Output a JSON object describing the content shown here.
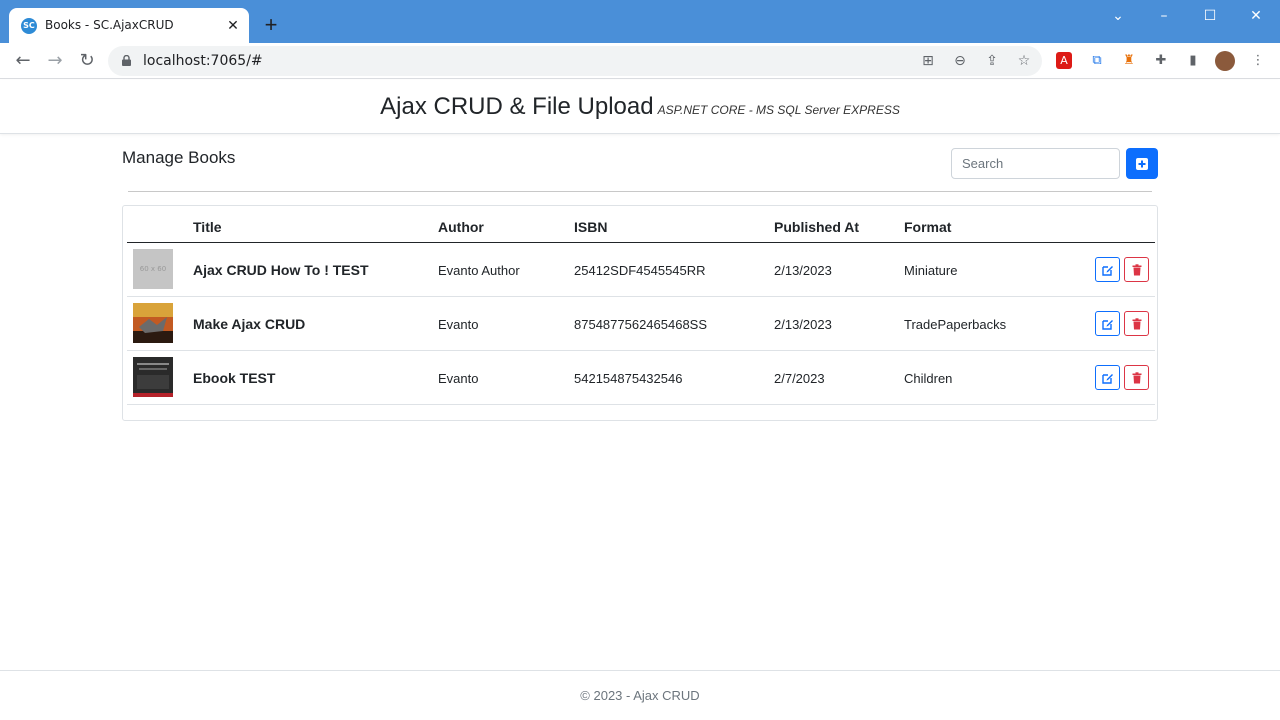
{
  "browser": {
    "tab_title": "Books - SC.AjaxCRUD",
    "favicon_text": "SC",
    "url": "localhost:7065/#"
  },
  "header": {
    "title": "Ajax CRUD & File Upload",
    "subtitle": "ASP.NET CORE - MS SQL Server EXPRESS"
  },
  "main": {
    "title": "Manage Books",
    "search_placeholder": "Search",
    "columns": [
      "Title",
      "Author",
      "ISBN",
      "Published At",
      "Format"
    ],
    "rows": [
      {
        "title": "Ajax CRUD How To ! TEST",
        "author": "Evanto Author",
        "isbn": "25412SDF4545545RR",
        "published": "2/13/2023",
        "format": "Miniature",
        "thumb": "60 x 60"
      },
      {
        "title": "Make Ajax CRUD",
        "author": "Evanto",
        "isbn": "8754877562465468SS",
        "published": "2/13/2023",
        "format": "TradePaperbacks"
      },
      {
        "title": "Ebook TEST",
        "author": "Evanto",
        "isbn": "542154875432546",
        "published": "2/7/2023",
        "format": "Children"
      }
    ]
  },
  "footer": {
    "text": "© 2023 - Ajax CRUD"
  },
  "colors": {
    "primary": "#0d6efd",
    "danger": "#dc3545",
    "titlebar": "#4a8fd8"
  }
}
